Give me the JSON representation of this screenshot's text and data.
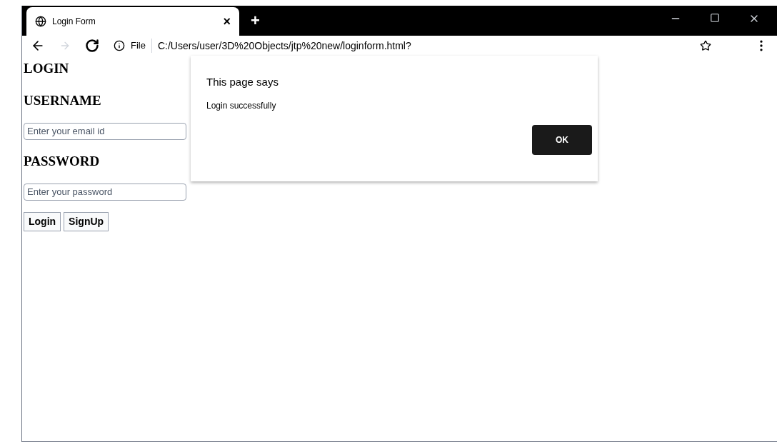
{
  "tab": {
    "title": "Login Form",
    "selected": true,
    "close": "×"
  },
  "new_tab": "+",
  "address_bar": {
    "scheme": "File",
    "url": "C:/Users/user/3D%20Objects/jtp%20new/loginform.html?"
  },
  "page": {
    "heading": "LOGIN",
    "fields": [
      {
        "label": "USERNAME",
        "placeholder": "Enter your email id"
      },
      {
        "label": "PASSWORD",
        "placeholder": "Enter your password"
      }
    ],
    "buttons": [
      "Login",
      "SignUp"
    ]
  },
  "dialog": {
    "title": "This page says",
    "message": "Login successfully",
    "button": "OK"
  }
}
